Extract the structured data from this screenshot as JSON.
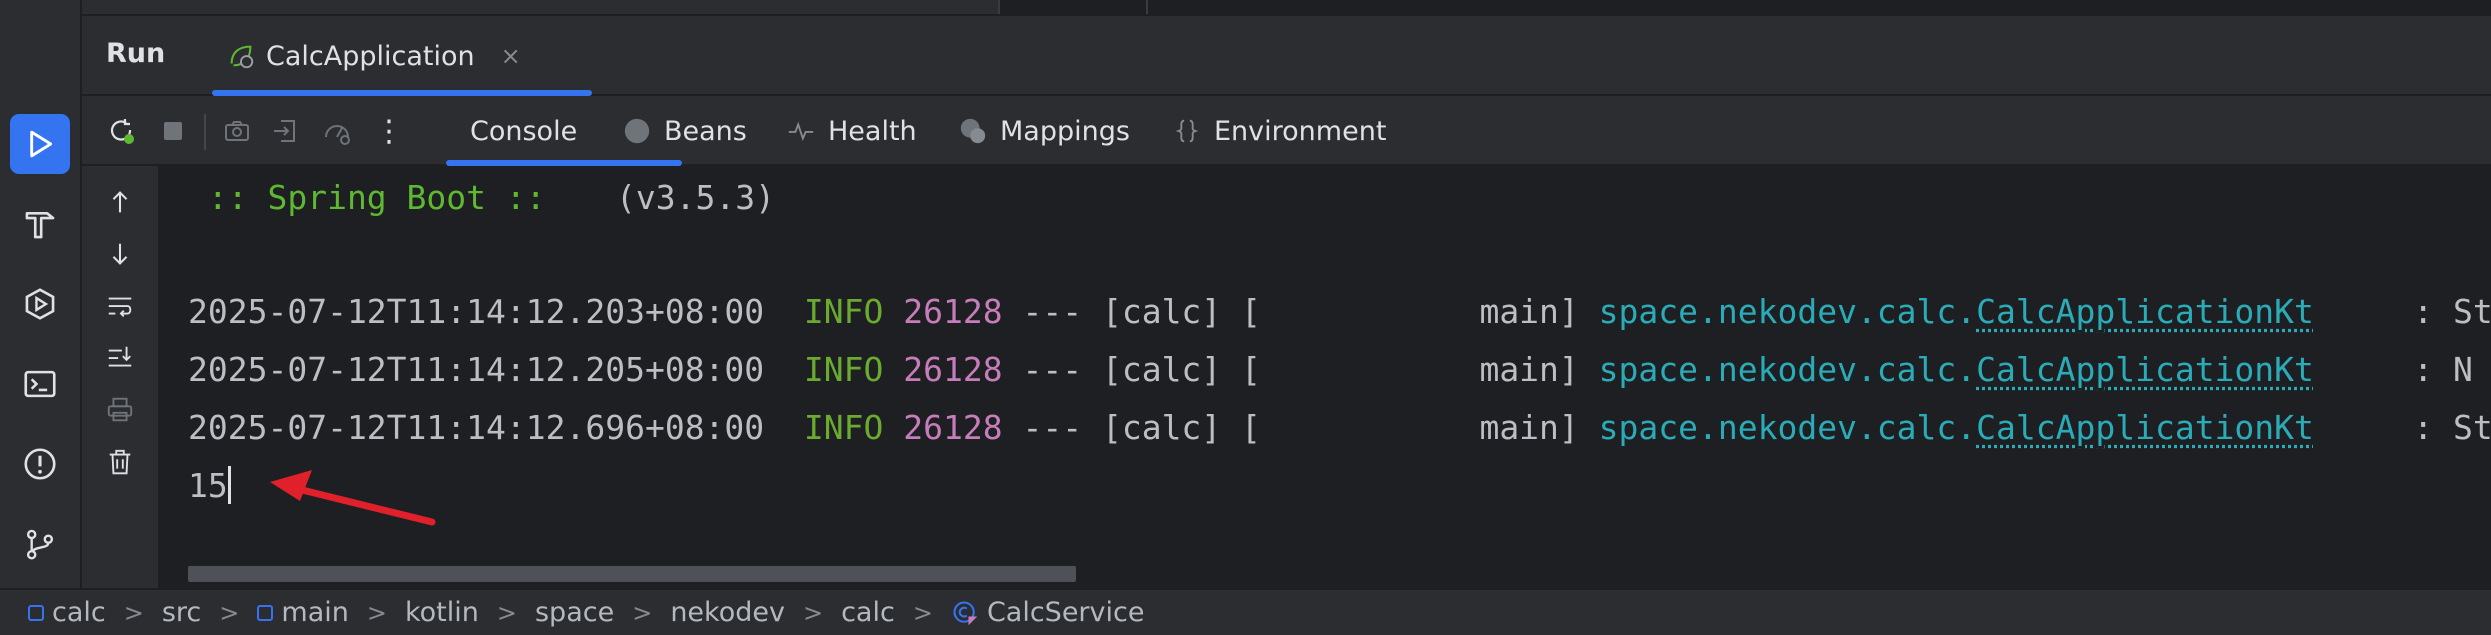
{
  "tool_window": {
    "title": "Run",
    "run_tab": {
      "label": "CalcApplication",
      "icon": "spring-run-icon",
      "close": "×"
    }
  },
  "left_strip": [
    "run-icon",
    "build-icon",
    "services-icon",
    "terminal-icon",
    "problems-icon",
    "git-icon"
  ],
  "toolbar": {
    "icons": [
      "rerun-icon",
      "stop-icon",
      "screenshot-icon",
      "exit-icon",
      "gauge-icon",
      "more-icon"
    ],
    "more_label": "⋮",
    "tabs": [
      {
        "label": "Console",
        "icon": "",
        "selected": true
      },
      {
        "label": "Beans",
        "icon": "beans-icon",
        "selected": false
      },
      {
        "label": "Health",
        "icon": "health-icon",
        "selected": false
      },
      {
        "label": "Mappings",
        "icon": "mappings-icon",
        "selected": false
      },
      {
        "label": "Environment",
        "icon": "environment-icon",
        "selected": false
      }
    ]
  },
  "gutter_icons": [
    "scroll-up-icon",
    "scroll-down-icon",
    "soft-wrap-icon",
    "scroll-to-end-icon",
    "print-icon",
    "clear-icon"
  ],
  "console": {
    "banner": {
      "left": " :: Spring Boot ::",
      "right": "(v3.5.3)"
    },
    "lines": [
      {
        "timestamp": "2025-07-12T11:14:12.203+08:00",
        "level": "INFO",
        "pid": "26128",
        "mid": " --- [calc] [           main] ",
        "pkg": "space.nekodev.calc.",
        "cls": "CalcApplicationKt",
        "tail": "     : St"
      },
      {
        "timestamp": "2025-07-12T11:14:12.205+08:00",
        "level": "INFO",
        "pid": "26128",
        "mid": " --- [calc] [           main] ",
        "pkg": "space.nekodev.calc.",
        "cls": "CalcApplicationKt",
        "tail": "     : N"
      },
      {
        "timestamp": "2025-07-12T11:14:12.696+08:00",
        "level": "INFO",
        "pid": "26128",
        "mid": " --- [calc] [           main] ",
        "pkg": "space.nekodev.calc.",
        "cls": "CalcApplicationKt",
        "tail": "     : St"
      }
    ],
    "input": "15"
  },
  "breadcrumb": [
    {
      "label": "calc",
      "icon": "module-icon"
    },
    {
      "label": "src",
      "icon": ""
    },
    {
      "label": "main",
      "icon": "module-icon"
    },
    {
      "label": "kotlin",
      "icon": ""
    },
    {
      "label": "space",
      "icon": ""
    },
    {
      "label": "nekodev",
      "icon": ""
    },
    {
      "label": "calc",
      "icon": ""
    },
    {
      "label": "CalcService",
      "icon": "kotlin-class-icon"
    }
  ],
  "breadcrumb_separator": ">",
  "colors": {
    "accent": "#3574f0",
    "info": "#6aab2f",
    "pid": "#c77dbb",
    "class": "#2aacb8",
    "spring": "#5fb832",
    "annotation": "#e0202a"
  }
}
